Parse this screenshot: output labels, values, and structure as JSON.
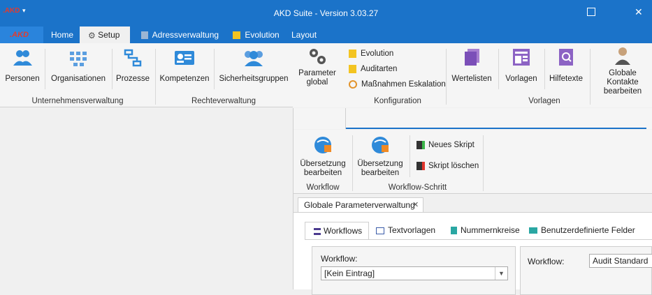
{
  "app": {
    "title": "AKD Suite - Version 3.03.27",
    "logo": ".AKD"
  },
  "tabs": [
    "Home",
    "Setup",
    "Adressverwaltung",
    "Evolution",
    "Layout"
  ],
  "ribbon": {
    "personen": "Personen",
    "organisationen": "Organisationen",
    "prozesse": "Prozesse",
    "kompetenzen": "Kompetenzen",
    "sicherheitsgruppen": "Sicherheitsgruppen",
    "parameter_global_1": "Parameter",
    "parameter_global_2": "global",
    "evolution": "Evolution",
    "auditarten": "Auditarten",
    "massnahmen": "Maßnahmen Eskalation",
    "wertelisten": "Wertelisten",
    "vorlagen": "Vorlagen",
    "hilfetexte": "Hilfetexte",
    "globale_kontakte_1": "Globale Kontakte",
    "globale_kontakte_2": "bearbeiten",
    "groups": {
      "unternehmen": "Unternehmensverwaltung",
      "rechte": "Rechteverwaltung",
      "konfig": "Konfiguration",
      "vorlagen": "Vorlagen"
    }
  },
  "ribbon2": {
    "uebersetzung_1": "Übersetzung",
    "uebersetzung_2": "bearbeiten",
    "neues_skript": "Neues Skript",
    "skript_loeschen": "Skript löschen",
    "groups": {
      "workflow": "Workflow",
      "workflow_schritt": "Workflow-Schritt"
    }
  },
  "doc_tab": {
    "label": "Globale Parameterverwaltung",
    "close": "✕"
  },
  "inner_tabs": [
    "Workflows",
    "Textvorlagen",
    "Nummernkreise",
    "Benutzerdefinierte Felder"
  ],
  "workflow_panel": {
    "label": "Workflow:",
    "value": "[Kein Eintrag]"
  },
  "right_panel": {
    "label": "Workflow:",
    "value": "Audit Standard"
  },
  "colors": {
    "brand": "#1b73c9",
    "accent_orange": "#e2932b"
  }
}
